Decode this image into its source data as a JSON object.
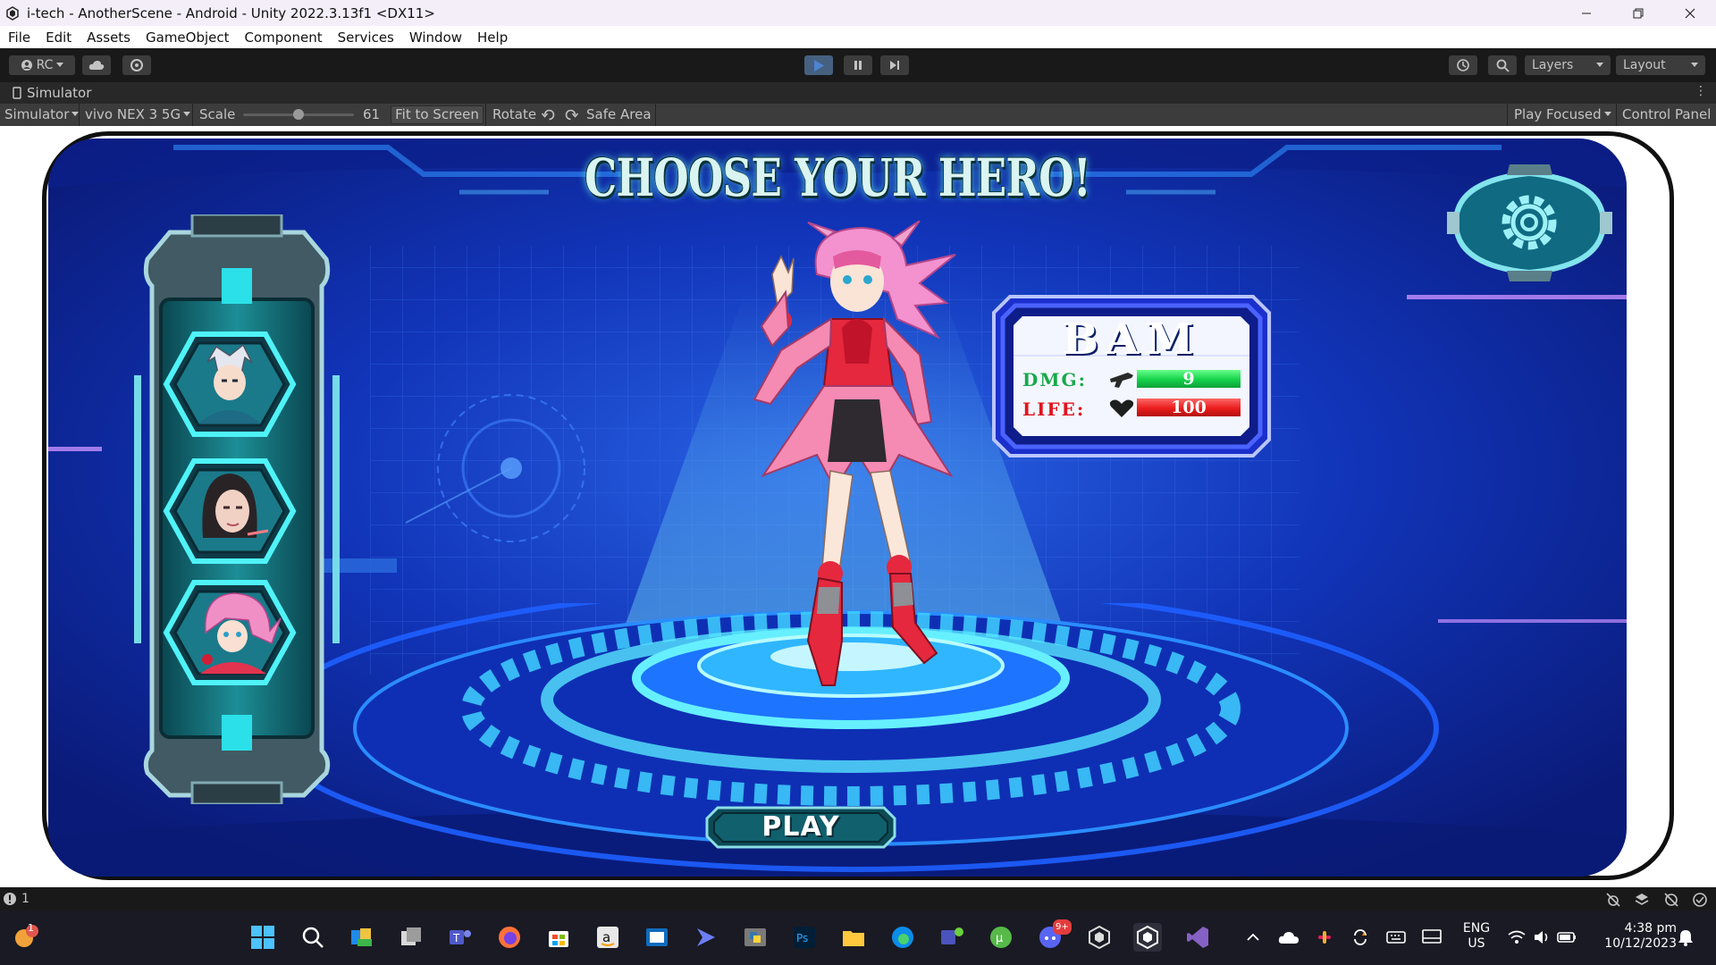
{
  "window": {
    "title": "i-tech - AnotherScene - Android - Unity 2022.3.13f1 <DX11>"
  },
  "menu": {
    "items": [
      "File",
      "Edit",
      "Assets",
      "GameObject",
      "Component",
      "Services",
      "Window",
      "Help"
    ]
  },
  "toolbar": {
    "account_label": "RC",
    "layers_label": "Layers",
    "layout_label": "Layout"
  },
  "simulator": {
    "tab_label": "Simulator",
    "mode_label": "Simulator",
    "device_label": "vivo NEX 3 5G",
    "scale_label": "Scale",
    "scale_value": "61",
    "scale_fraction": 0.5,
    "fit_label": "Fit to Screen",
    "rotate_label": "Rotate",
    "safe_area_label": "Safe Area",
    "play_focused_label": "Play Focused",
    "control_panel_label": "Control Panel"
  },
  "game": {
    "title": "CHOOSE YOUR HERO!",
    "hero_name": "BAM",
    "dmg_label": "DMG:",
    "dmg_value": "9",
    "life_label": "LIFE:",
    "life_value": "100",
    "play_label": "PLAY"
  },
  "status": {
    "message_count": "1"
  },
  "taskbar": {
    "notification_badge": "1",
    "discord_badge": "9+",
    "language": "ENG",
    "region": "US",
    "time": "4:38 pm",
    "date": "10/12/2023"
  },
  "colors": {
    "unity_dark": "#191919",
    "unity_panel": "#3c3c3c",
    "play_active": "#4d84d2",
    "screen_bg": "#0d2aa8",
    "neon_cyan": "#5fe6e6",
    "dmg_green": "#14d149",
    "life_red": "#ea1d1d"
  }
}
